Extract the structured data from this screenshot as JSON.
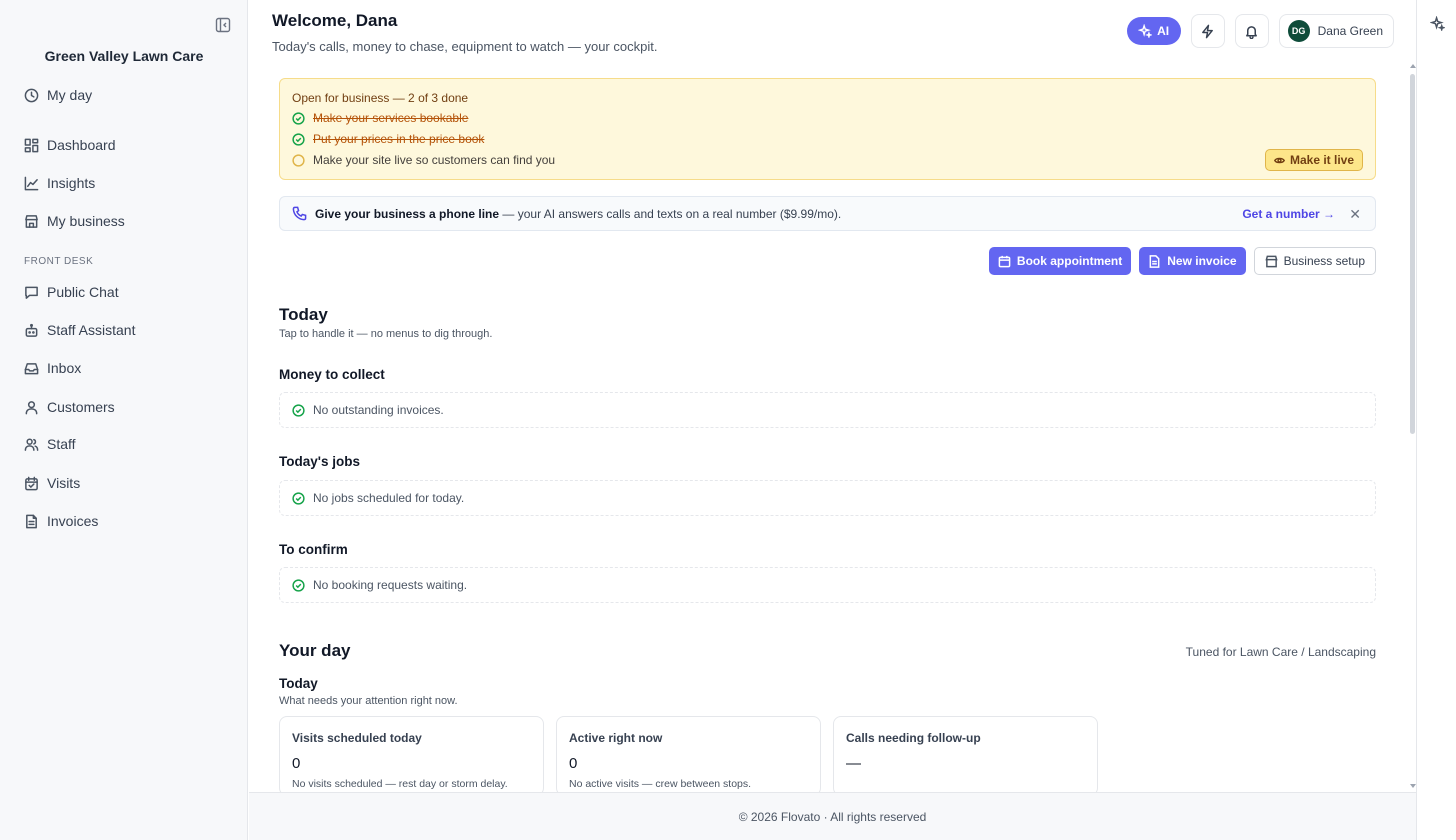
{
  "sidebar": {
    "brand": "Green Valley Lawn Care",
    "items": [
      {
        "label": "My day",
        "icon": "clock-icon"
      },
      {
        "label": "Dashboard",
        "icon": "dashboard-icon"
      },
      {
        "label": "Insights",
        "icon": "chart-line-icon"
      },
      {
        "label": "My business",
        "icon": "store-icon"
      },
      {
        "label": "Public Chat",
        "icon": "chat-bubble-icon"
      },
      {
        "label": "Staff Assistant",
        "icon": "bot-icon"
      },
      {
        "label": "Inbox",
        "icon": "inbox-icon"
      },
      {
        "label": "Customers",
        "icon": "user-icon"
      },
      {
        "label": "Staff",
        "icon": "users-icon"
      },
      {
        "label": "Visits",
        "icon": "calendar-check-icon"
      },
      {
        "label": "Invoices",
        "icon": "document-icon"
      }
    ],
    "section_front_desk": "FRONT DESK"
  },
  "header": {
    "welcome": "Welcome, Dana",
    "subtitle": "Today's calls, money to chase, equipment to watch — your cockpit.",
    "ai_label": "AI",
    "user_initials": "DG",
    "user_name": "Dana Green"
  },
  "onboarding": {
    "title": "Open for business — 2 of 3 done",
    "tasks": [
      {
        "label": "Make your services bookable",
        "done": true
      },
      {
        "label": "Put your prices in the price book",
        "done": true
      },
      {
        "label": "Make your site live so customers can find you",
        "done": false
      }
    ],
    "cta": "Make it live"
  },
  "phone_banner": {
    "bold": "Give your business a phone line",
    "text": " — your AI answers calls and texts on a real number ($9.99/mo).",
    "link": "Get a number →",
    "close": "✕"
  },
  "actions": {
    "book": "Book appointment",
    "invoice": "New invoice",
    "setup": "Business setup"
  },
  "today": {
    "title": "Today",
    "subtitle": "Tap to handle it — no menus to dig through.",
    "sections": [
      {
        "title": "Money to collect",
        "empty": "No outstanding invoices."
      },
      {
        "title": "Today's jobs",
        "empty": "No jobs scheduled for today."
      },
      {
        "title": "To confirm",
        "empty": "No booking requests waiting."
      }
    ]
  },
  "your_day": {
    "title": "Your day",
    "tuned": "Tuned for Lawn Care / Landscaping",
    "sub_title": "Today",
    "sub_desc": "What needs your attention right now.",
    "cards": [
      {
        "label": "Visits scheduled today",
        "value": "0",
        "note": "No visits scheduled — rest day or storm delay."
      },
      {
        "label": "Active right now",
        "value": "0",
        "note": "No active visits — crew between stops."
      },
      {
        "label": "Calls needing follow-up",
        "value": "—",
        "note": ""
      }
    ]
  },
  "footer": "© 2026 Flovato · All rights reserved",
  "colors": {
    "accent": "#6366f1",
    "success": "#16a34a",
    "warning_bg": "#fef8dc"
  }
}
